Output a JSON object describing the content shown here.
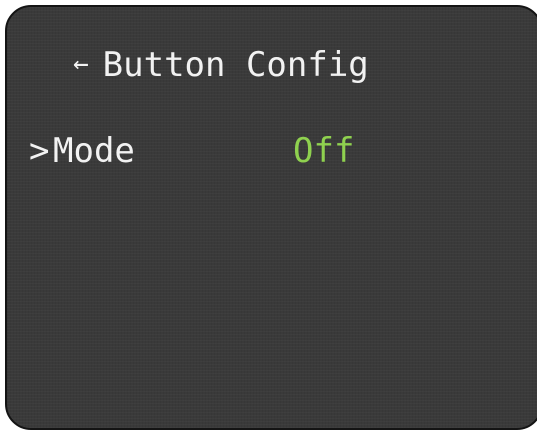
{
  "header": {
    "back_icon": "←",
    "title": "Button Config"
  },
  "menu": {
    "items": [
      {
        "cursor": ">",
        "label": "Mode",
        "value": "Off",
        "selected": true
      }
    ]
  },
  "colors": {
    "background": "#3a3a3a",
    "text": "#f2f2f2",
    "value_accent": "#8fd14f",
    "border": "#141414"
  }
}
